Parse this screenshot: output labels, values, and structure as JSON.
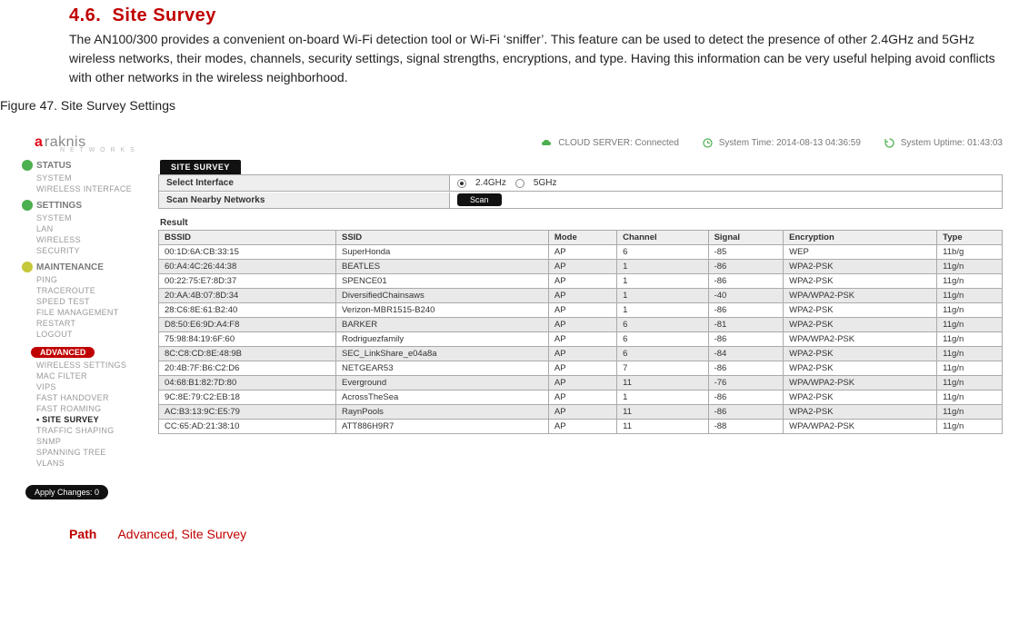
{
  "doc": {
    "section_no": "4.6.",
    "section_title": "Site Survey",
    "body": "The AN100/300 provides a convenient on-board Wi-Fi detection tool or Wi-Fi ‘sniffer’. This feature can be used to detect the presence of other 2.4GHz and 5GHz wireless networks, their modes, channels, security settings, signal strengths, encryptions, and type. Having this information can be very useful helping avoid conflicts with other networks in the wireless neighborhood.",
    "figure_caption": "Figure 47. Site Survey Settings",
    "path_label": "Path",
    "path_value": "Advanced, Site Survey"
  },
  "shot": {
    "brand_a": "a",
    "brand_rest": "raknis",
    "brand_sub": "N E T W O R K S",
    "cloud_label": "CLOUD SERVER:",
    "cloud_value": "Connected",
    "systime_label": "System Time:",
    "systime_value": "2014-08-13 04:36:59",
    "uptime_label": "System Uptime:",
    "uptime_value": "01:43:03",
    "tab": "SITE SURVEY",
    "select_iface_label": "Select Interface",
    "iface_24": "2.4GHz",
    "iface_5": "5GHz",
    "scan_label": "Scan Nearby Networks",
    "scan_btn": "Scan",
    "result_label": "Result",
    "apply_changes": "Apply Changes: 0",
    "sidebar": {
      "g1_head": "STATUS",
      "g1": [
        "SYSTEM",
        "WIRELESS INTERFACE"
      ],
      "g2_head": "SETTINGS",
      "g2": [
        "SYSTEM",
        "LAN",
        "WIRELESS",
        "SECURITY"
      ],
      "g3_head": "MAINTENANCE",
      "g3": [
        "PING",
        "TRACEROUTE",
        "SPEED TEST",
        "FILE MANAGEMENT",
        "RESTART",
        "LOGOUT"
      ],
      "g4_head": "ADVANCED",
      "g4": [
        "WIRELESS SETTINGS",
        "MAC FILTER",
        "VIPS",
        "FAST HANDOVER",
        "FAST ROAMING",
        "SITE SURVEY",
        "TRAFFIC SHAPING",
        "SNMP",
        "SPANNING TREE",
        "VLANS"
      ]
    },
    "cols": [
      "BSSID",
      "SSID",
      "Mode",
      "Channel",
      "Signal",
      "Encryption",
      "Type"
    ],
    "rows": [
      {
        "bssid": "00:1D:6A:CB:33:15",
        "ssid": "SuperHonda",
        "mode": "AP",
        "ch": "6",
        "sig": "-85",
        "enc": "WEP",
        "type": "11b/g"
      },
      {
        "bssid": "60:A4:4C:26:44:38",
        "ssid": "BEATLES",
        "mode": "AP",
        "ch": "1",
        "sig": "-86",
        "enc": "WPA2-PSK",
        "type": "11g/n"
      },
      {
        "bssid": "00:22:75:E7:8D:37",
        "ssid": "SPENCE01",
        "mode": "AP",
        "ch": "1",
        "sig": "-86",
        "enc": "WPA2-PSK",
        "type": "11g/n"
      },
      {
        "bssid": "20:AA:4B:07:8D:34",
        "ssid": "DiversifiedChainsaws",
        "mode": "AP",
        "ch": "1",
        "sig": "-40",
        "enc": "WPA/WPA2-PSK",
        "type": "11g/n"
      },
      {
        "bssid": "28:C6:8E:61:B2:40",
        "ssid": "Verizon-MBR1515-B240",
        "mode": "AP",
        "ch": "1",
        "sig": "-86",
        "enc": "WPA2-PSK",
        "type": "11g/n"
      },
      {
        "bssid": "D8:50:E6:9D:A4:F8",
        "ssid": "BARKER",
        "mode": "AP",
        "ch": "6",
        "sig": "-81",
        "enc": "WPA2-PSK",
        "type": "11g/n"
      },
      {
        "bssid": "75:98:84:19:6F:60",
        "ssid": "Rodriguezfamily",
        "mode": "AP",
        "ch": "6",
        "sig": "-86",
        "enc": "WPA/WPA2-PSK",
        "type": "11g/n"
      },
      {
        "bssid": "8C:C8:CD:8E:48:9B",
        "ssid": "SEC_LinkShare_e04a8a",
        "mode": "AP",
        "ch": "6",
        "sig": "-84",
        "enc": "WPA2-PSK",
        "type": "11g/n"
      },
      {
        "bssid": "20:4B:7F:B6:C2:D6",
        "ssid": "NETGEAR53",
        "mode": "AP",
        "ch": "7",
        "sig": "-86",
        "enc": "WPA2-PSK",
        "type": "11g/n"
      },
      {
        "bssid": "04:68:B1:82:7D:80",
        "ssid": "Everground",
        "mode": "AP",
        "ch": "11",
        "sig": "-76",
        "enc": "WPA/WPA2-PSK",
        "type": "11g/n"
      },
      {
        "bssid": "9C:8E:79:C2:EB:18",
        "ssid": "AcrossTheSea",
        "mode": "AP",
        "ch": "1",
        "sig": "-86",
        "enc": "WPA2-PSK",
        "type": "11g/n"
      },
      {
        "bssid": "AC:B3:13:9C:E5:79",
        "ssid": "RaynPools",
        "mode": "AP",
        "ch": "11",
        "sig": "-86",
        "enc": "WPA2-PSK",
        "type": "11g/n"
      },
      {
        "bssid": "CC:65:AD:21:38:10",
        "ssid": "ATT886H9R7",
        "mode": "AP",
        "ch": "11",
        "sig": "-88",
        "enc": "WPA/WPA2-PSK",
        "type": "11g/n"
      }
    ]
  }
}
